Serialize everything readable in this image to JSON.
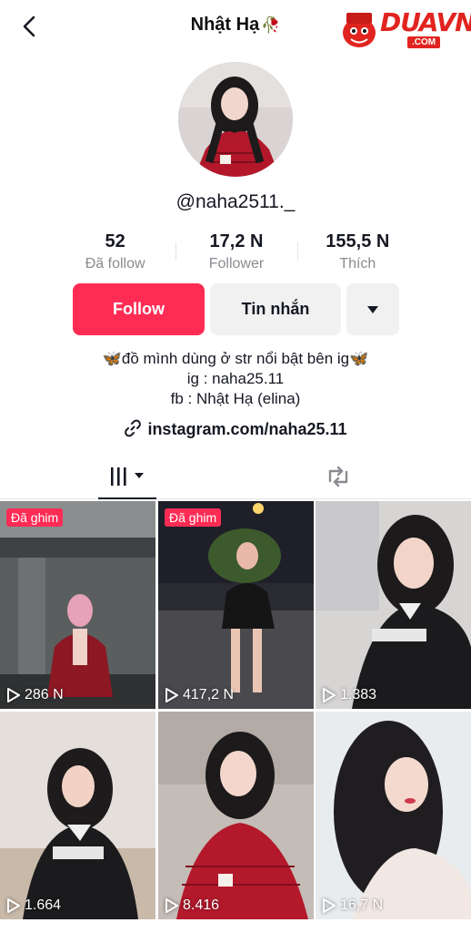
{
  "header": {
    "title": "Nhật Hạ",
    "title_emoji": "🥀",
    "watermark": {
      "text": "DUAVN",
      "sub": ".COM"
    }
  },
  "profile": {
    "username": "@naha2511._",
    "stats": [
      {
        "value": "52",
        "label": "Đã follow"
      },
      {
        "value": "17,2 N",
        "label": "Follower"
      },
      {
        "value": "155,5 N",
        "label": "Thích"
      }
    ]
  },
  "actions": {
    "follow_label": "Follow",
    "message_label": "Tin nhắn"
  },
  "bio": {
    "line1": "đồ mình dùng ở str nổi bật bên ig",
    "line2": "ig : naha25.11",
    "line3": "fb : Nhật Hạ (elina)",
    "link": "instagram.com/naha25.11"
  },
  "tabs": {
    "videos": "grid-videos-icon",
    "reposts": "repost-icon"
  },
  "videos": [
    {
      "pinned": "Đã ghim",
      "views": "286 N"
    },
    {
      "pinned": "Đã ghim",
      "views": "417,2 N"
    },
    {
      "pinned": "",
      "views": "1.383"
    },
    {
      "pinned": "",
      "views": "1.664"
    },
    {
      "pinned": "",
      "views": "8.416"
    },
    {
      "pinned": "",
      "views": "16,7 N"
    }
  ],
  "colors": {
    "accent": "#fe2c55",
    "secondary_button": "#f1f1f2",
    "muted_text": "#8a8b91"
  }
}
